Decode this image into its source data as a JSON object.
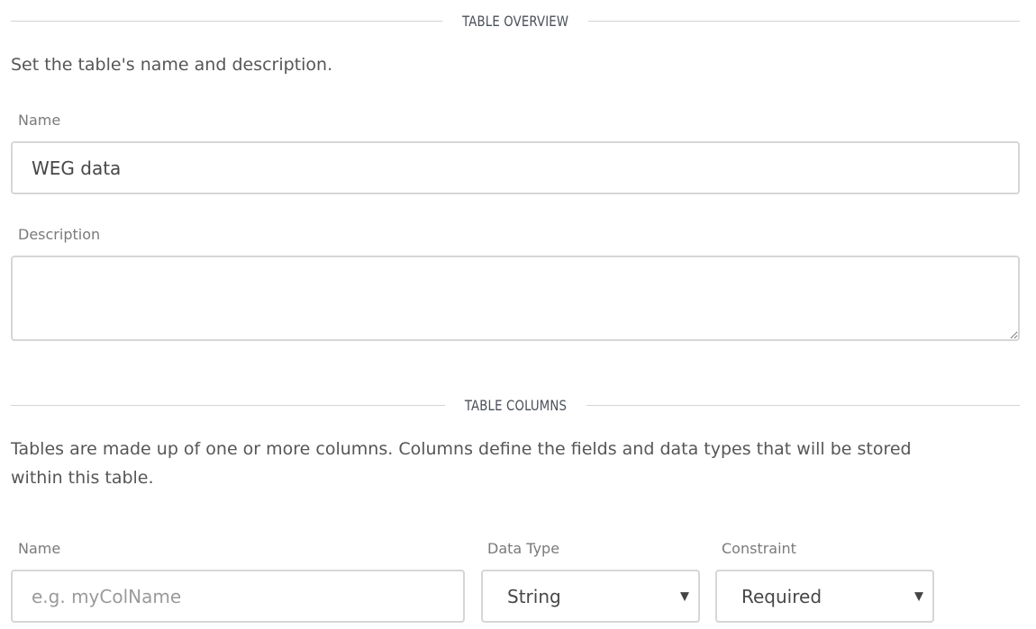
{
  "overview": {
    "section_title": "TABLE OVERVIEW",
    "description": "Set the table's name and description.",
    "name_label": "Name",
    "name_value": "WEG data",
    "description_label": "Description",
    "description_value": ""
  },
  "columns": {
    "section_title": "TABLE COLUMNS",
    "description_line1": "Tables are made up of one or more columns. Columns define the fields and data types that will be stored",
    "description_line2": "within this table.",
    "name_label": "Name",
    "name_placeholder": "e.g. myColName",
    "data_type_label": "Data Type",
    "data_type_value": "String",
    "constraint_label": "Constraint",
    "constraint_value": "Required"
  },
  "icons": {
    "select_arrow": "chevron-down-icon",
    "resize": "resize-grip-icon"
  }
}
